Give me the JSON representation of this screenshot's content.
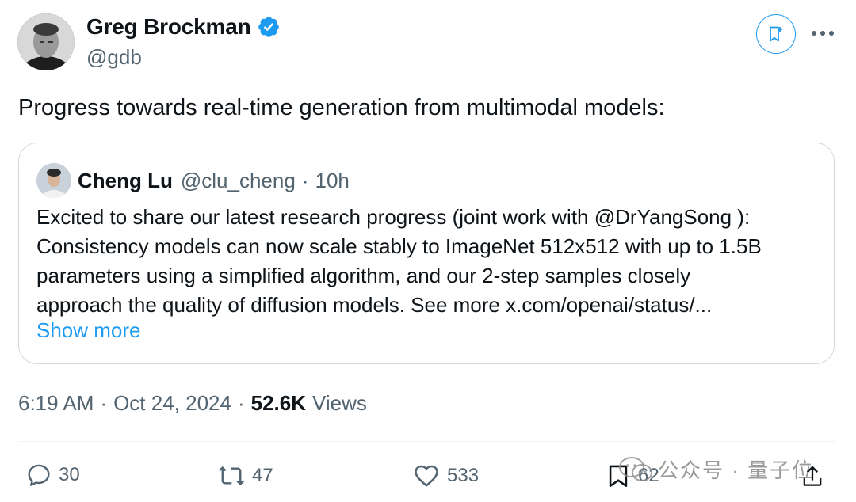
{
  "author": {
    "name": "Greg Brockman",
    "handle": "@gdb"
  },
  "tweet": {
    "text": "Progress towards real-time generation from multimodal models:"
  },
  "quote": {
    "name": "Cheng Lu",
    "handle": "@clu_cheng",
    "separator": "·",
    "time": "10h",
    "lines": [
      "Excited to share our latest research progress (joint work with @DrYangSong ):",
      "Consistency models can now scale stably to ImageNet 512x512 with up to 1.5B",
      "parameters using a simplified algorithm, and our 2-step samples closely",
      "approach the quality of diffusion models. See more x.com/openai/status/..."
    ],
    "show_more": "Show more"
  },
  "meta": {
    "time": "6:19 AM",
    "sep": "·",
    "date": "Oct 24, 2024",
    "views_count": "52.6K",
    "views_label": "Views"
  },
  "actions": {
    "replies": "30",
    "reposts": "47",
    "likes": "533",
    "bookmarks": "62"
  },
  "watermark": {
    "text": "公众号 · 量子位"
  },
  "colors": {
    "accent": "#1d9bf0",
    "secondary_text": "#536471",
    "border": "#cfd9de"
  },
  "icons": [
    "verified-badge-icon",
    "subscribe-icon",
    "more-icon",
    "reply-icon",
    "repost-icon",
    "like-icon",
    "bookmark-icon",
    "share-icon"
  ]
}
